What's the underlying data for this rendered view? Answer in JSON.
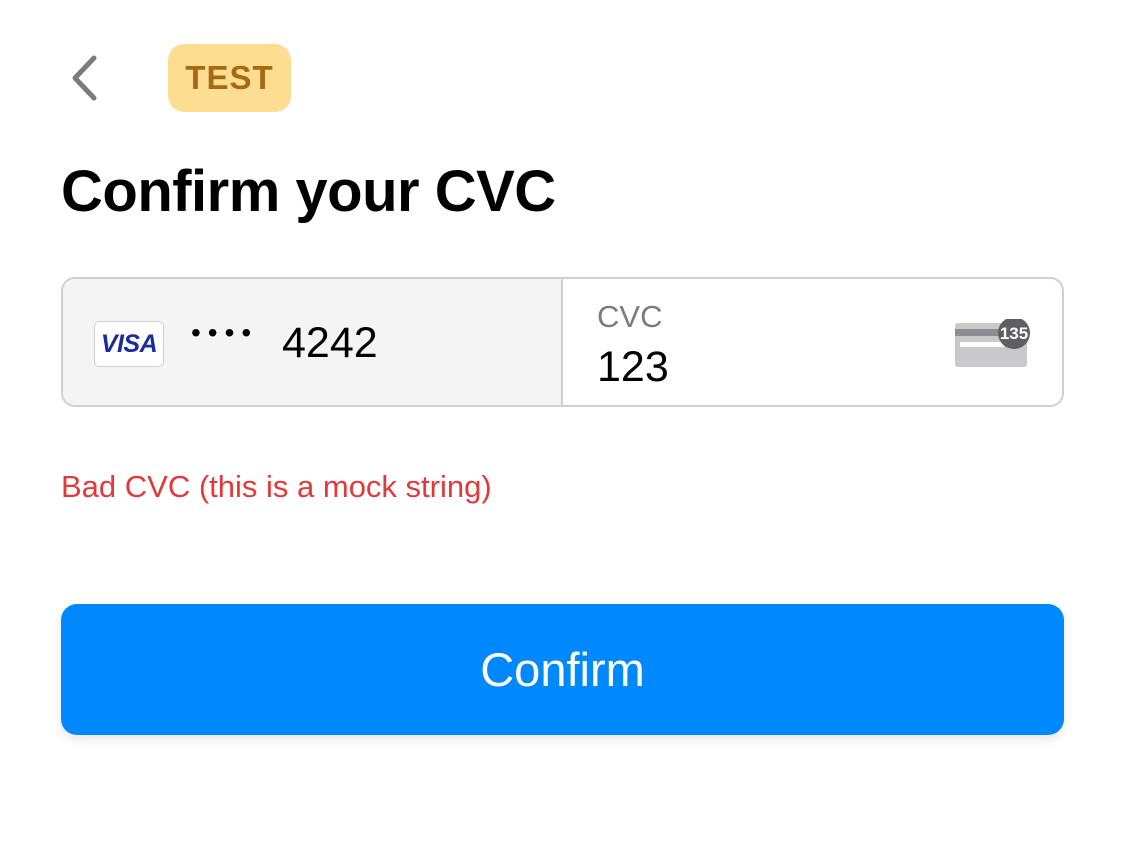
{
  "header": {
    "back_icon": "chevron-left-icon",
    "badge_label": "TEST"
  },
  "title": "Confirm your CVC",
  "card": {
    "brand": "VISA",
    "masked_dots": "••••",
    "last4": "4242"
  },
  "cvc": {
    "label": "CVC",
    "value": "123",
    "icon": "card-cvc-icon",
    "icon_badge": "135"
  },
  "error": "Bad CVC (this is a mock string)",
  "confirm_label": "Confirm",
  "colors": {
    "accent": "#0088ff",
    "error": "#e5383b",
    "badge_bg": "#fddd92",
    "badge_text": "#a66a12",
    "visa_blue": "#1a2d9c"
  }
}
